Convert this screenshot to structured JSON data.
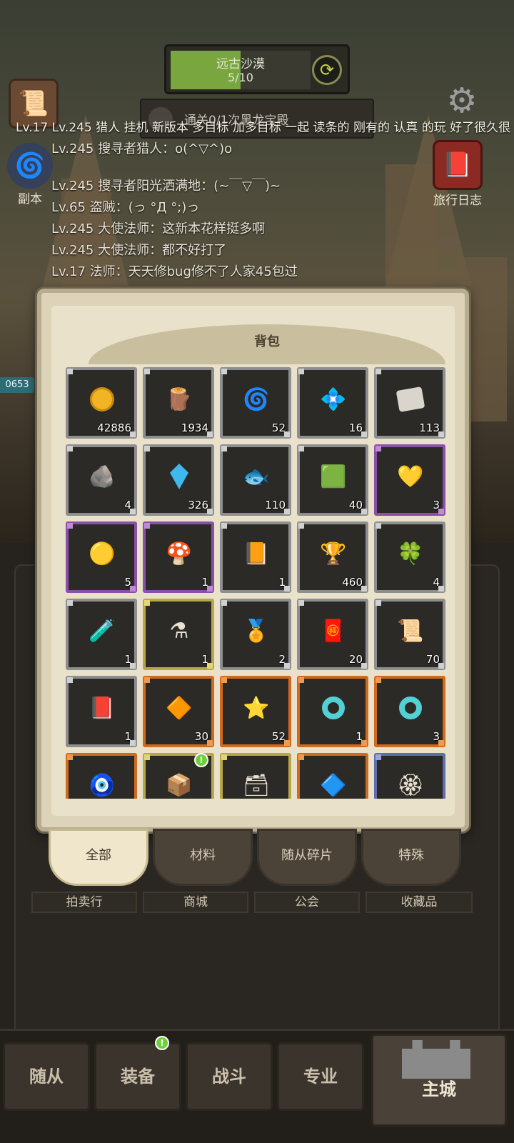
{
  "zone": {
    "name": "远古沙漠",
    "progress_text": "5/10",
    "progress_fraction": 0.5,
    "cycle_icon": "cycle-icon"
  },
  "quest": {
    "text": "通关0/1次黑龙宝殿"
  },
  "side": {
    "left_top_label": "",
    "left_dungeon_label": "副本",
    "right_log_label": "旅行日志",
    "counter": "0653"
  },
  "chat": [
    "Lv.17 Lv.245 猎人 挂机 新版本 多目标 加多目标 一起 读条的 刚有的 认真 的玩 好了很久很",
    "Lv.245 搜寻者猎人：o(^▽^)o",
    "Lv.245 搜寻者阳光洒满地：(~￣▽￣)~",
    "Lv.65 盗贼：(っ °Д °;)っ",
    "Lv.245 大使法师：这新本花样挺多啊",
    "Lv.245 大使法师：都不好打了",
    "Lv.17 法师：天天修bug修不了人家45包过"
  ],
  "bag": {
    "title": "背包",
    "items": [
      {
        "icon": "gold-coin-icon",
        "count": "42886",
        "rarity": "gray"
      },
      {
        "icon": "wood-log-icon",
        "count": "1934",
        "rarity": "gray"
      },
      {
        "icon": "blue-rune-stone-icon",
        "count": "52",
        "rarity": "gray"
      },
      {
        "icon": "crystal-shard-icon",
        "count": "16",
        "rarity": "gray"
      },
      {
        "icon": "parchment-scroll-icon",
        "count": "113",
        "rarity": "gray"
      },
      {
        "icon": "gray-rune-stone-icon",
        "count": "4",
        "rarity": "gray"
      },
      {
        "icon": "blue-gem-icon",
        "count": "326",
        "rarity": "gray"
      },
      {
        "icon": "fish-fossil-icon",
        "count": "110",
        "rarity": "gray"
      },
      {
        "icon": "green-square-coin-icon",
        "count": "40",
        "rarity": "gray"
      },
      {
        "icon": "gold-drop-gem-icon",
        "count": "3",
        "rarity": "purple"
      },
      {
        "icon": "gold-nugget-icon",
        "count": "5",
        "rarity": "purple"
      },
      {
        "icon": "gold-mushroom-icon",
        "count": "1",
        "rarity": "purple"
      },
      {
        "icon": "exp-book-icon",
        "count": "1",
        "rarity": "gray"
      },
      {
        "icon": "trophy-icon",
        "count": "460",
        "rarity": "gray"
      },
      {
        "icon": "clover-icon",
        "count": "4",
        "rarity": "gray"
      },
      {
        "icon": "red-potion-icon",
        "count": "1",
        "rarity": "gray"
      },
      {
        "icon": "blue-potion-icon",
        "count": "1",
        "rarity": "gold"
      },
      {
        "icon": "gold-medal-icon",
        "count": "2",
        "rarity": "gray"
      },
      {
        "icon": "red-pouch-icon",
        "count": "20",
        "rarity": "gray"
      },
      {
        "icon": "orange-scroll-icon",
        "count": "70",
        "rarity": "gray"
      },
      {
        "icon": "red-scroll-icon",
        "count": "1",
        "rarity": "gray"
      },
      {
        "icon": "orange-ore-icon",
        "count": "30",
        "rarity": "orange"
      },
      {
        "icon": "yellow-ore-icon",
        "count": "52",
        "rarity": "orange"
      },
      {
        "icon": "cyan-ring-icon",
        "count": "1",
        "rarity": "orange"
      },
      {
        "icon": "cyan-ring-icon",
        "count": "3",
        "rarity": "orange"
      },
      {
        "icon": "orange-eye-stone-icon",
        "count": "",
        "rarity": "orange"
      },
      {
        "icon": "relic-box-icon",
        "count": "",
        "rarity": "gold",
        "alert": "!"
      },
      {
        "icon": "blue-relic-box-icon",
        "count": "",
        "rarity": "gold"
      },
      {
        "icon": "sapphire-icon",
        "count": "",
        "rarity": "orange"
      },
      {
        "icon": "ruby-emblem-icon",
        "count": "",
        "rarity": "blue"
      }
    ]
  },
  "tabs": [
    "全部",
    "材料",
    "随从碎片",
    "特殊"
  ],
  "underbars": [
    "拍卖行",
    "商城",
    "公会",
    "收藏品"
  ],
  "nav": [
    {
      "label": "随从"
    },
    {
      "label": "装备",
      "badge": "!"
    },
    {
      "label": "战斗"
    },
    {
      "label": "专业"
    },
    {
      "label": "主城"
    }
  ]
}
